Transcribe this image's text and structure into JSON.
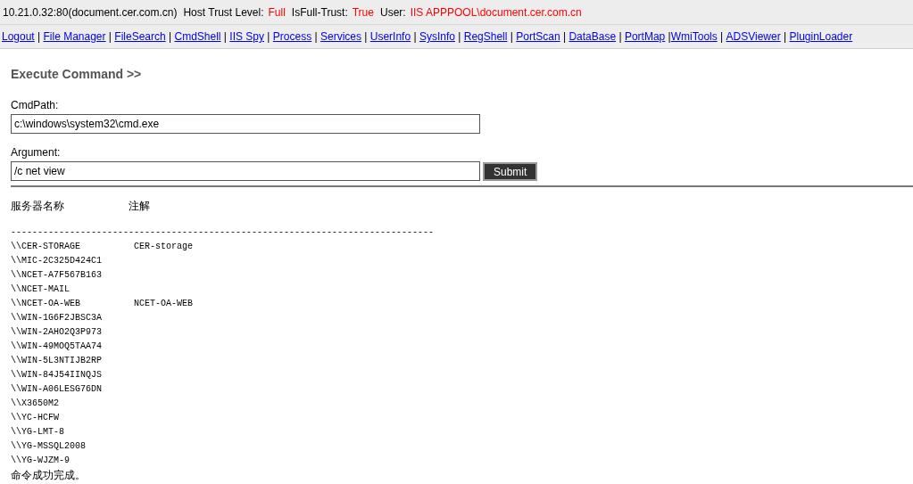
{
  "info_bar": [
    {
      "label": "10.21.0.32:80(document.cer.com.cn)"
    },
    {
      "label": "Host Trust Level:",
      "value": "Full"
    },
    {
      "label": "IsFull-Trust:",
      "value": "True"
    },
    {
      "label": "User:",
      "value": "IIS APPPOOL\\document.cer.com.cn"
    }
  ],
  "nav": [
    {
      "label": "Logout"
    },
    {
      "label": "File Manager",
      "separator": " | "
    },
    {
      "label": "FileSearch",
      "separator": " | "
    },
    {
      "label": "CmdShell",
      "separator": " | "
    },
    {
      "label": "IIS Spy",
      "separator": " | "
    },
    {
      "label": "Process",
      "separator": " | "
    },
    {
      "label": "Services",
      "separator": " | "
    },
    {
      "label": "UserInfo",
      "separator": " | "
    },
    {
      "label": "SysInfo",
      "separator": " | "
    },
    {
      "label": "RegShell",
      "separator": " | "
    },
    {
      "label": "PortScan",
      "separator": " | "
    },
    {
      "label": "DataBase",
      "separator": " | "
    },
    {
      "label": "PortMap",
      "separator": " | "
    },
    {
      "label": "WmiTools",
      "separator": " |"
    },
    {
      "label": "ADSViewer",
      "separator": " | "
    },
    {
      "label": "PluginLoader",
      "separator": " | "
    }
  ],
  "heading": "Execute Command >>",
  "cmd_path": {
    "label": "CmdPath:",
    "value": "c:\\windows\\system32\\cmd.exe"
  },
  "argument": {
    "label": "Argument:",
    "value": "/c net view"
  },
  "submit": "Submit",
  "output": {
    "columns": [
      "服务器名称",
      "注解"
    ],
    "divider": "-------------------------------------------------------------------------------",
    "rows": [
      {
        "name": "\\\\CER-STORAGE",
        "remark": "CER-storage"
      },
      {
        "name": "\\\\MIC-2C325D424C1",
        "remark": ""
      },
      {
        "name": "\\\\NCET-A7F567B163",
        "remark": ""
      },
      {
        "name": "\\\\NCET-MAIL",
        "remark": ""
      },
      {
        "name": "\\\\NCET-OA-WEB",
        "remark": "NCET-OA-WEB"
      },
      {
        "name": "\\\\WIN-1G6F2JBSC3A",
        "remark": ""
      },
      {
        "name": "\\\\WIN-2AHO2Q3P973",
        "remark": ""
      },
      {
        "name": "\\\\WIN-49MOQ5TAA74",
        "remark": ""
      },
      {
        "name": "\\\\WIN-5L3NTIJB2RP",
        "remark": ""
      },
      {
        "name": "\\\\WIN-84J54IINQJS",
        "remark": ""
      },
      {
        "name": "\\\\WIN-A06LESG76DN",
        "remark": ""
      },
      {
        "name": "\\\\X3650M2",
        "remark": ""
      },
      {
        "name": "\\\\YC-HCFW",
        "remark": ""
      },
      {
        "name": "\\\\YG-LMT-8",
        "remark": ""
      },
      {
        "name": "\\\\YG-MSSQL2008",
        "remark": ""
      },
      {
        "name": "\\\\YG-WJZM-9",
        "remark": ""
      }
    ],
    "footer": "命令成功完成。"
  }
}
